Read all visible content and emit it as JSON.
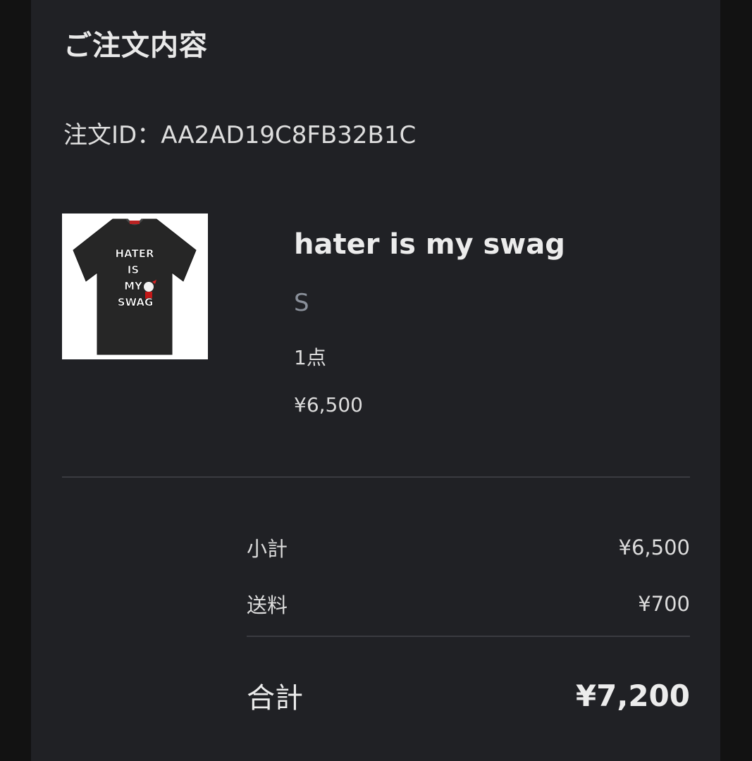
{
  "header": {
    "title": "ご注文内容"
  },
  "order": {
    "id_label": "注文ID：AA2AD19C8FB32B1C"
  },
  "item": {
    "image_text_lines": [
      "HATER",
      "IS",
      "MY",
      "SWAG"
    ],
    "name": "hater is my swag",
    "variant": "S",
    "quantity": "1点",
    "price": "¥6,500"
  },
  "summary": {
    "subtotal_label": "小計",
    "subtotal_value": "¥6,500",
    "shipping_label": "送料",
    "shipping_value": "¥700",
    "total_label": "合計",
    "total_value": "¥7,200"
  },
  "colors": {
    "background": "#121212",
    "panel": "#202125",
    "muted_text": "#8a909a",
    "divider": "#3a3b40"
  }
}
